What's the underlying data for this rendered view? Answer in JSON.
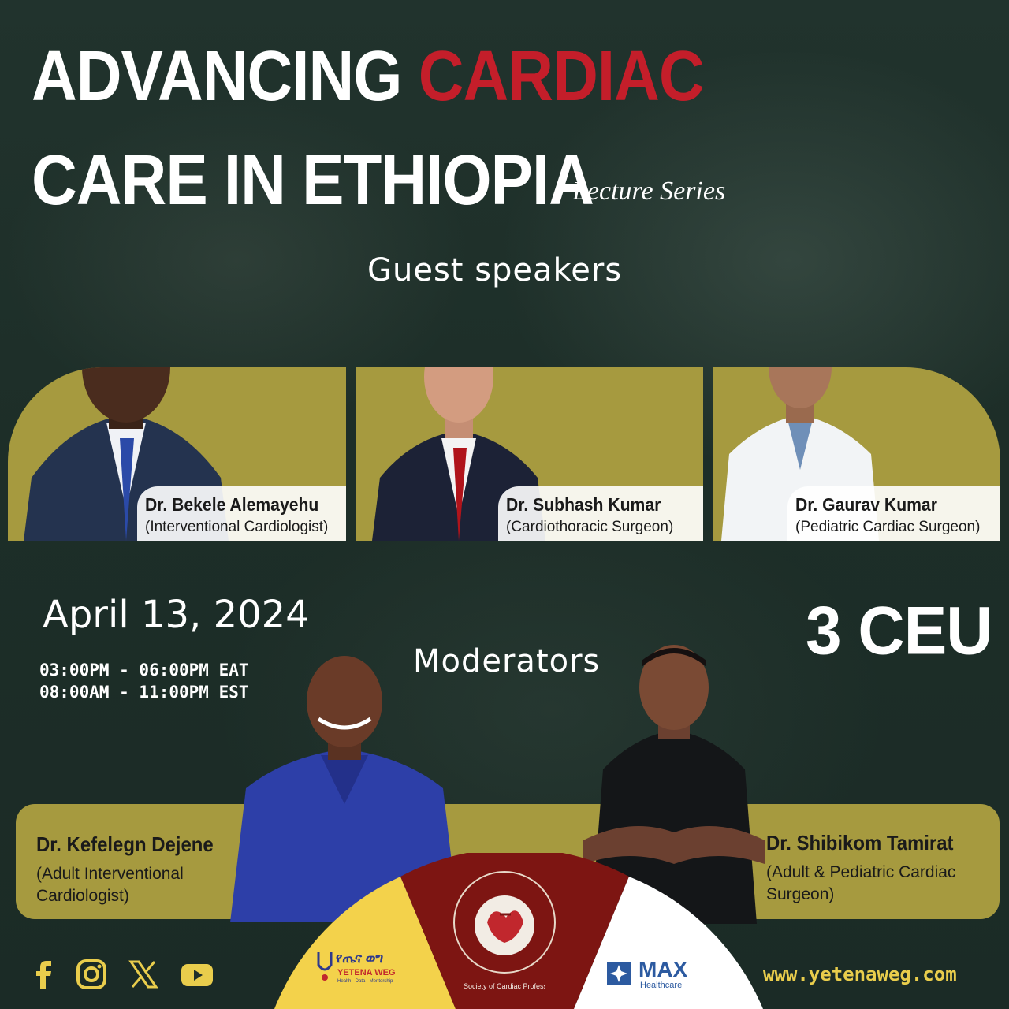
{
  "colors": {
    "accent_red": "#c41e2a",
    "card_olive": "#a69a3f",
    "background": "#1f2f2a",
    "site_yellow": "#e9cd4c",
    "logo_maroon": "#7d1512"
  },
  "header": {
    "title_part1": "ADVANCING",
    "title_highlight": "CARDIAC",
    "title_line2": "CARE IN ETHIOPIA",
    "series_label": "Lecture Series"
  },
  "guest_section_title": "Guest speakers",
  "speakers": [
    {
      "name": "Dr. Bekele Alemayehu",
      "role": "(Interventional Cardiologist)"
    },
    {
      "name": "Dr. Subhash Kumar",
      "role": "(Cardiothoracic Surgeon)"
    },
    {
      "name": "Dr. Gaurav Kumar",
      "role": "(Pediatric Cardiac Surgeon)"
    }
  ],
  "event": {
    "date": "April 13, 2024",
    "time_eat": "03:00PM - 06:00PM EAT",
    "time_est": "08:00AM - 11:00PM EST",
    "ceu": "3 CEU"
  },
  "moderators_title": "Moderators",
  "moderators": [
    {
      "name": "Dr. Kefelegn Dejene",
      "role_line1": "(Adult Interventional",
      "role_line2": "Cardiologist)"
    },
    {
      "name": "Dr. Shibikom Tamirat",
      "role_line1": "(Adult & Pediatric Cardiac",
      "role_line2": "Surgeon)"
    }
  ],
  "footer": {
    "social_icons": [
      "facebook-icon",
      "instagram-icon",
      "x-icon",
      "youtube-icon"
    ],
    "website": "www.yetenaweg.com",
    "yetena_logo_text": "YETENA WEG",
    "yetena_amharic": "የጤና ወግ",
    "yetena_tagline": "Health · Data · Mentorship",
    "max_logo_text": "MAX",
    "max_logo_sub": "Healthcare",
    "society_text": "Society of Cardiac Professionals - Ethiopia"
  }
}
